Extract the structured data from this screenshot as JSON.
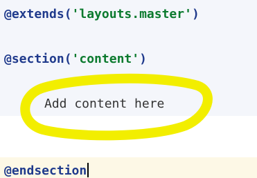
{
  "editor": {
    "lines": {
      "extends_directive": "@extends",
      "extends_open": "(",
      "extends_arg": "'layouts.master'",
      "extends_close": ")",
      "section_directive": "@section",
      "section_open": "(",
      "section_arg": "'content'",
      "section_close": ")",
      "placeholder": "Add content here",
      "endsection_directive": "@endsection"
    },
    "colors": {
      "directive": "#1f3a8c",
      "string": "#0b7a2e",
      "highlight_stroke": "#f2ee00",
      "code_block_bg": "#f4f6fb",
      "current_line_bg": "#fdf8e6"
    }
  }
}
